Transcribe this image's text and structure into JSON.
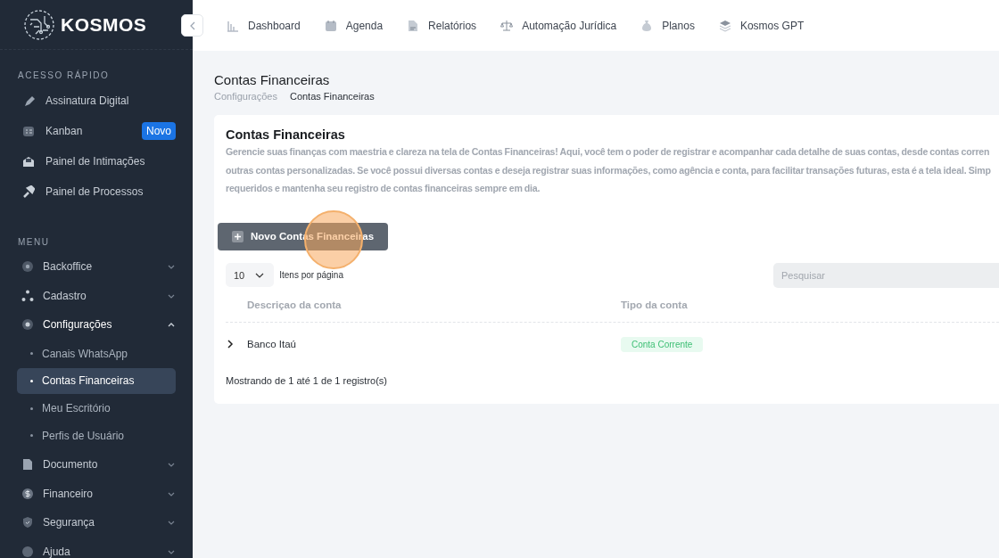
{
  "brand": "KOSMOS",
  "top_nav": [
    {
      "label": "Dashboard"
    },
    {
      "label": "Agenda"
    },
    {
      "label": "Relatórios"
    },
    {
      "label": "Automação Jurídica"
    },
    {
      "label": "Planos"
    },
    {
      "label": "Kosmos GPT"
    }
  ],
  "sidebar": {
    "quick_title": "ACESSO RÁPIDO",
    "quick_items": [
      {
        "label": "Assinatura Digital"
      },
      {
        "label": "Kanban",
        "badge": "Novo"
      },
      {
        "label": "Painel de Intimações"
      },
      {
        "label": "Painel de Processos"
      }
    ],
    "menu_title": "MENU",
    "menu_items": [
      {
        "label": "Backoffice",
        "expanded": false
      },
      {
        "label": "Cadastro",
        "expanded": false
      },
      {
        "label": "Configurações",
        "expanded": true,
        "children": [
          {
            "label": "Canais WhatsApp",
            "selected": false
          },
          {
            "label": "Contas Financeiras",
            "selected": true
          },
          {
            "label": "Meu Escritório",
            "selected": false
          },
          {
            "label": "Perfis de Usuário",
            "selected": false
          }
        ]
      },
      {
        "label": "Documento",
        "expanded": false
      },
      {
        "label": "Financeiro",
        "expanded": false
      },
      {
        "label": "Segurança",
        "expanded": false
      },
      {
        "label": "Ajuda",
        "expanded": false
      }
    ]
  },
  "page": {
    "title": "Contas Financeiras",
    "breadcrumb": [
      "Configurações",
      "Contas Financeiras"
    ]
  },
  "card": {
    "title": "Contas Financeiras",
    "description_lines": [
      "Gerencie suas finanças com maestria e clareza na tela de Contas Financeiras! Aqui, você tem o poder de registrar e acompanhar cada detalhe de suas contas, desde contas corren",
      "outras contas personalizadas. Se você possui diversas contas e deseja registrar suas informações, como agência e conta, para facilitar transações futuras, esta é a tela ideal. Simp",
      "requeridos e mantenha seu registro de contas financeiras sempre em dia."
    ],
    "new_button": "Novo Contas Financeiras",
    "page_size": "10",
    "page_size_label": "Itens por página",
    "search": {
      "placeholder": "Pesquisar"
    },
    "columns": [
      "Descriçao da conta",
      "Tipo da conta"
    ],
    "rows": [
      {
        "cells": [
          "Banco Itaú",
          "Conta Corrente"
        ],
        "expanded": false
      }
    ],
    "footer": "Mostrando de 1 até 1 de 1 registro(s)"
  }
}
